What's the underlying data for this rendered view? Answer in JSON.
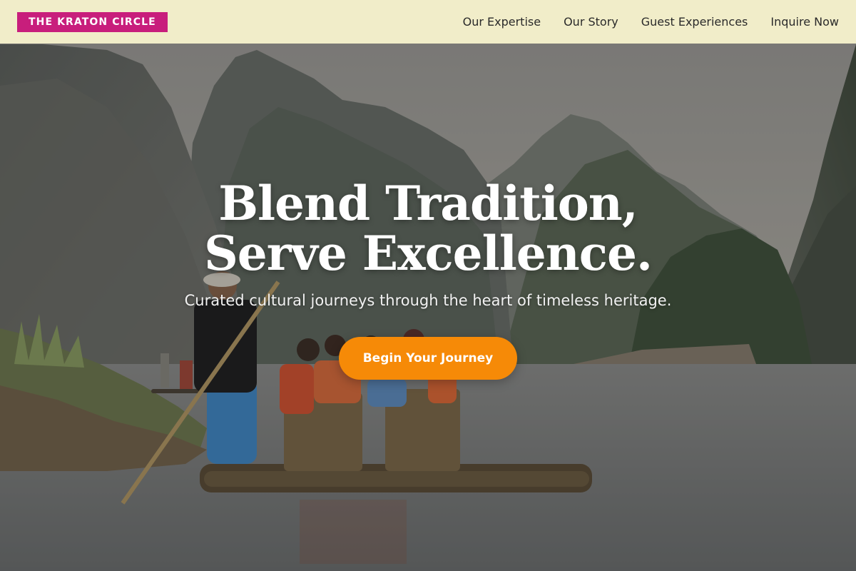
{
  "brand": {
    "logo_text": "THE KRATON CIRCLE",
    "logo_color": "#c81e7c",
    "header_bg": "#f8f3ce"
  },
  "nav": {
    "items": [
      {
        "label": "Our Expertise"
      },
      {
        "label": "Our Story"
      },
      {
        "label": "Guest Experiences"
      },
      {
        "label": "Inquire Now"
      }
    ]
  },
  "hero": {
    "title_line1": "Blend Tradition,",
    "title_line2": "Serve Excellence.",
    "subtitle": "Curated cultural journeys through the heart of timeless heritage.",
    "cta_label": "Begin Your Journey",
    "cta_color": "#f68a07",
    "background": "river-rafting-karst-mountains-photo"
  }
}
